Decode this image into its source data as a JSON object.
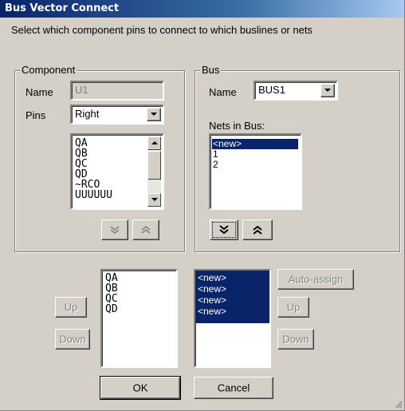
{
  "window": {
    "title": "Bus Vector Connect"
  },
  "instructions": "Select which component pins to connect to which buslines or nets",
  "component": {
    "legend": "Component",
    "name_label": "Name",
    "name_value": "U1",
    "pins_label": "Pins",
    "pins_value": "Right",
    "pins_list": [
      "QA",
      "QB",
      "QC",
      "QD",
      "~RCO",
      "UUUUUU"
    ],
    "move_down_icon": "double-chevron-down-icon",
    "move_up_icon": "double-chevron-up-icon"
  },
  "bus": {
    "legend": "Bus",
    "name_label": "Name",
    "name_value": "BUS1",
    "nets_label": "Nets in Bus:",
    "nets_list": [
      "<new>",
      "1",
      "2"
    ],
    "selected_net": "<new>"
  },
  "selected_pins": [
    "QA",
    "QB",
    "QC",
    "QD"
  ],
  "assigned_nets": [
    "<new>",
    "<new>",
    "<new>",
    "<new>"
  ],
  "buttons": {
    "up_left": "Up",
    "down_left": "Down",
    "auto_assign": "Auto-assign",
    "up_right": "Up",
    "down_right": "Down",
    "ok": "OK",
    "cancel": "Cancel"
  },
  "colors": {
    "titlebar": "#0a246a",
    "selection": "#0a246a",
    "face": "#d4d0c8"
  }
}
